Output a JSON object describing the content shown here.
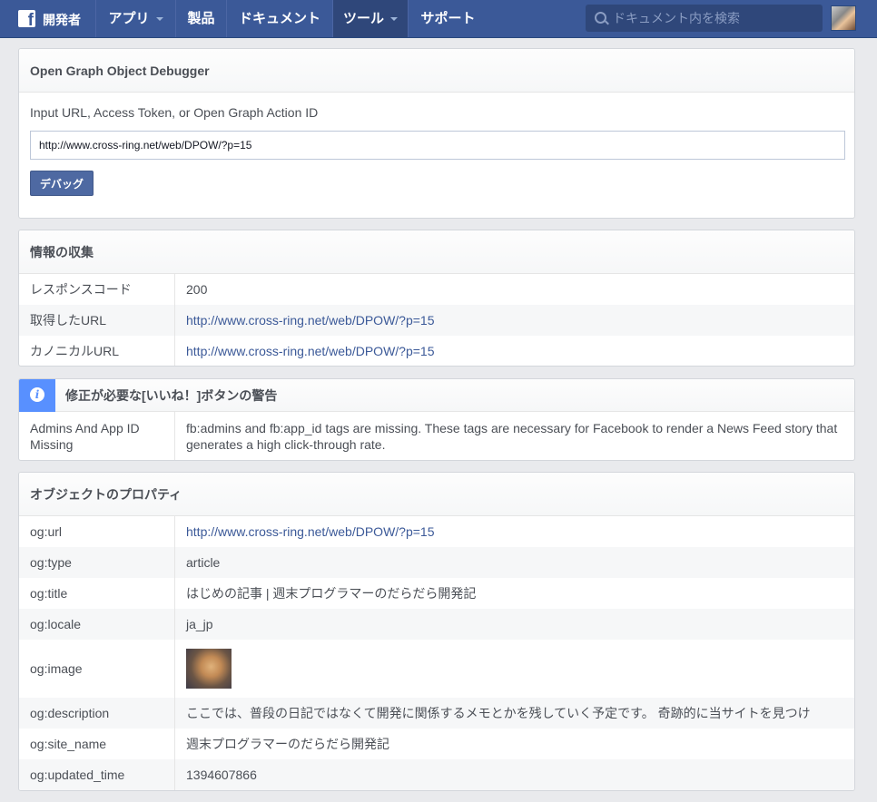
{
  "nav": {
    "brand": "開発者",
    "items": [
      {
        "label": "アプリ",
        "has_menu": true
      },
      {
        "label": "製品",
        "has_menu": false
      },
      {
        "label": "ドキュメント",
        "has_menu": false
      },
      {
        "label": "ツール",
        "has_menu": true,
        "active": true
      },
      {
        "label": "サポート",
        "has_menu": false
      }
    ],
    "search_placeholder": "ドキュメント内を検索"
  },
  "debugger": {
    "title": "Open Graph Object Debugger",
    "input_label": "Input URL, Access Token, or Open Graph Action ID",
    "input_value": "http://www.cross-ring.net/web/DPOW/?p=15",
    "button_label": "デバッグ"
  },
  "scrape": {
    "title": "情報の収集",
    "rows": [
      {
        "key": "レスポンスコード",
        "value": "200"
      },
      {
        "key": "取得したURL",
        "value": "http://www.cross-ring.net/web/DPOW/?p=15"
      },
      {
        "key": "カノニカルURL",
        "value": "http://www.cross-ring.net/web/DPOW/?p=15"
      }
    ]
  },
  "warning": {
    "title": "修正が必要な[いいね！]ボタンの警告",
    "key": "Admins And App ID Missing",
    "message": "fb:admins and fb:app_id tags are missing. These tags are necessary for Facebook to render a News Feed story that generates a high click-through rate."
  },
  "properties": {
    "title": "オブジェクトのプロパティ",
    "rows": [
      {
        "key": "og:url",
        "value": "http://www.cross-ring.net/web/DPOW/?p=15"
      },
      {
        "key": "og:type",
        "value": "article"
      },
      {
        "key": "og:title",
        "value": "はじめの記事 | 週末プログラマーのだらだら開発記"
      },
      {
        "key": "og:locale",
        "value": "ja_jp"
      },
      {
        "key": "og:image",
        "value": ""
      },
      {
        "key": "og:description",
        "value": "ここでは、普段の日記ではなくて開発に関係するメモとかを残していく予定です。 奇跡的に当サイトを見つけ"
      },
      {
        "key": "og:site_name",
        "value": "週末プログラマーのだらだら開発記"
      },
      {
        "key": "og:updated_time",
        "value": "1394607866"
      }
    ]
  },
  "colors": {
    "nav_bg": "#3b5998",
    "link": "#3b5998",
    "info_badge": "#5890ff"
  },
  "icons": [
    "facebook-logo-icon",
    "chevron-down-icon",
    "search-icon",
    "info-icon"
  ]
}
